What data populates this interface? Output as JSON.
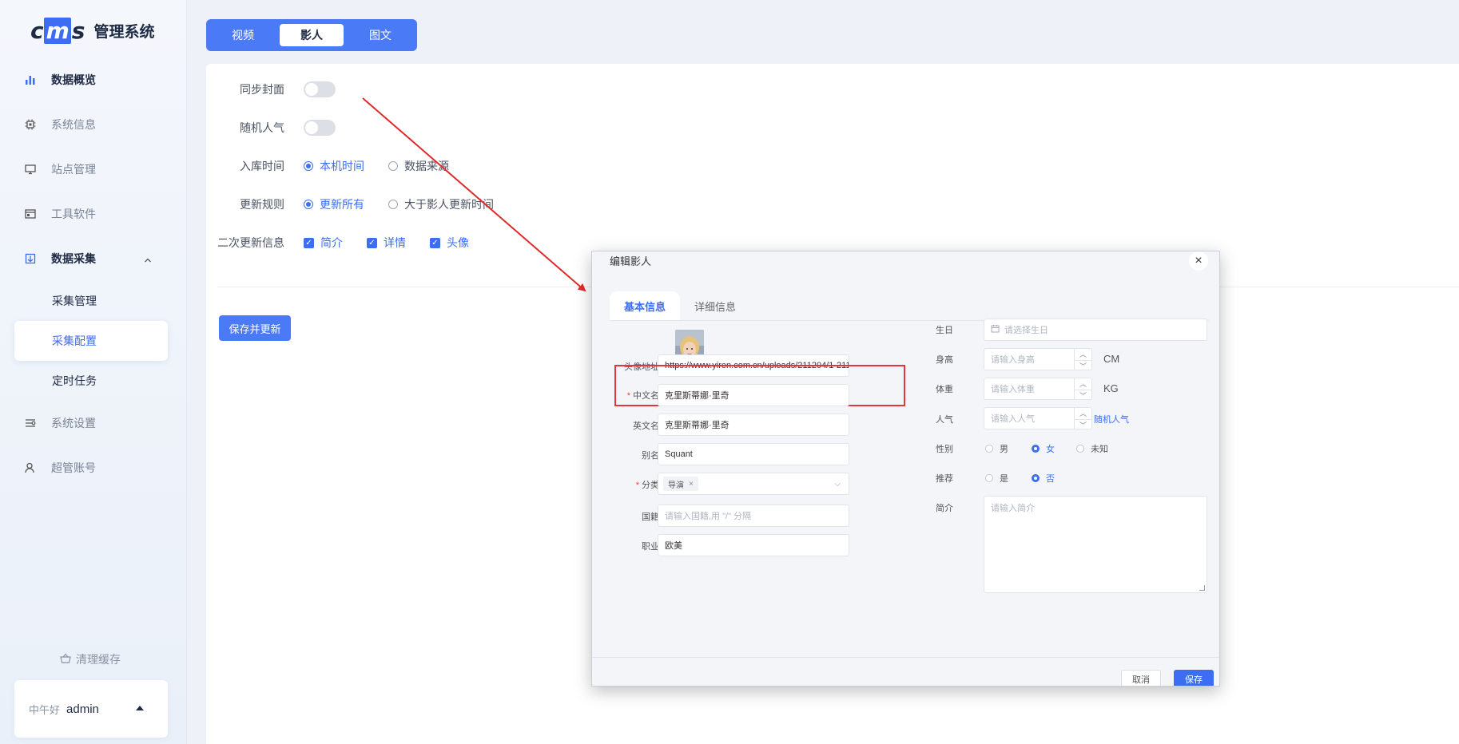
{
  "app": {
    "logo": "cms",
    "title": "管理系统"
  },
  "sidebar": {
    "items": [
      {
        "label": "数据概览",
        "icon": "bar-chart-icon"
      },
      {
        "label": "系统信息",
        "icon": "chip-icon"
      },
      {
        "label": "站点管理",
        "icon": "monitor-icon"
      },
      {
        "label": "工具软件",
        "icon": "window-icon"
      },
      {
        "label": "数据采集",
        "icon": "collect-icon"
      },
      {
        "label": "系统设置",
        "icon": "settings-sliders-icon"
      },
      {
        "label": "超管账号",
        "icon": "user-icon"
      }
    ],
    "sub_items": [
      {
        "label": "采集管理"
      },
      {
        "label": "采集配置"
      },
      {
        "label": "定时任务"
      }
    ],
    "clear_cache": "清理缓存",
    "user": {
      "greeting": "中午好",
      "name": "admin"
    }
  },
  "top_tabs": [
    {
      "label": "视频"
    },
    {
      "label": "影人"
    },
    {
      "label": "图文"
    }
  ],
  "form": {
    "sync_cover": {
      "label": "同步封面"
    },
    "random_popularity": {
      "label": "随机人气"
    },
    "storage_time": {
      "label": "入库时间",
      "options": [
        "本机时间",
        "数据来源"
      ]
    },
    "update_rule": {
      "label": "更新规则",
      "options": [
        "更新所有",
        "大于影人更新时间"
      ]
    },
    "secondary_update": {
      "label": "二次更新信息",
      "options": [
        "简介",
        "详情",
        "头像"
      ]
    },
    "save_button": "保存并更新"
  },
  "dialog": {
    "title": "编辑影人",
    "tabs": [
      "基本信息",
      "详细信息"
    ],
    "left": {
      "avatar_url": {
        "label": "头像地址",
        "value": "https://www.yiren.com.cn/uploads/211204/1-2112"
      },
      "chinese_name": {
        "label": "中文名",
        "value": "克里斯蒂娜·里奇"
      },
      "english_name": {
        "label": "英文名",
        "value": "克里斯蒂娜·里奇"
      },
      "alias": {
        "label": "别名",
        "value": "Squant"
      },
      "category": {
        "label": "分类",
        "tag": "导演",
        "tag_close": "×"
      },
      "nationality": {
        "label": "国籍",
        "placeholder": "请输入国籍,用 \"/\" 分隔"
      },
      "occupation": {
        "label": "职业",
        "value": "欧美"
      }
    },
    "right": {
      "birthday": {
        "label": "生日",
        "placeholder": "请选择生日"
      },
      "height": {
        "label": "身高",
        "placeholder": "请输入身高",
        "unit": "CM"
      },
      "weight": {
        "label": "体重",
        "placeholder": "请输入体重",
        "unit": "KG"
      },
      "popularity": {
        "label": "人气",
        "placeholder": "请输入人气",
        "link": "随机人气"
      },
      "gender": {
        "label": "性别",
        "options": [
          "男",
          "女",
          "未知"
        ]
      },
      "recommend": {
        "label": "推荐",
        "options": [
          "是",
          "否"
        ]
      },
      "intro": {
        "label": "简介",
        "placeholder": "请输入简介"
      }
    },
    "cancel": "取消",
    "save": "保存"
  },
  "colors": {
    "primary": "#3d6df2",
    "highlight_box": "#e5343a",
    "arrow": "#e02a2a"
  }
}
